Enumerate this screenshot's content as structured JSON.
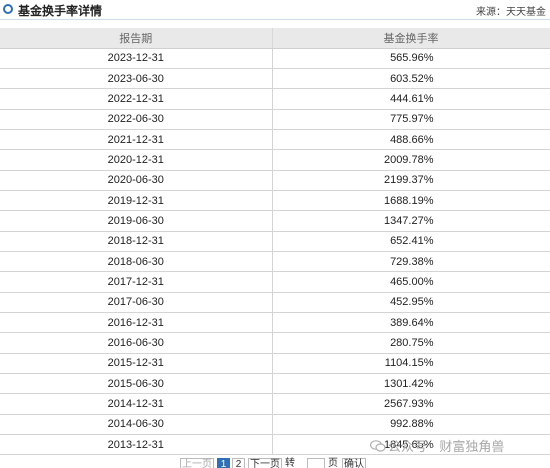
{
  "header": {
    "title": "基金换手率详情",
    "source": "来源：天天基金"
  },
  "table": {
    "columns": [
      "报告期",
      "基金换手率"
    ],
    "rows": [
      {
        "date": "2023-12-31",
        "rate": "565.96%"
      },
      {
        "date": "2023-06-30",
        "rate": "603.52%"
      },
      {
        "date": "2022-12-31",
        "rate": "444.61%"
      },
      {
        "date": "2022-06-30",
        "rate": "775.97%"
      },
      {
        "date": "2021-12-31",
        "rate": "488.66%"
      },
      {
        "date": "2020-12-31",
        "rate": "2009.78%"
      },
      {
        "date": "2020-06-30",
        "rate": "2199.37%"
      },
      {
        "date": "2019-12-31",
        "rate": "1688.19%"
      },
      {
        "date": "2019-06-30",
        "rate": "1347.27%"
      },
      {
        "date": "2018-12-31",
        "rate": "652.41%"
      },
      {
        "date": "2018-06-30",
        "rate": "729.38%"
      },
      {
        "date": "2017-12-31",
        "rate": "465.00%"
      },
      {
        "date": "2017-06-30",
        "rate": "452.95%"
      },
      {
        "date": "2016-12-31",
        "rate": "389.64%"
      },
      {
        "date": "2016-06-30",
        "rate": "280.75%"
      },
      {
        "date": "2015-12-31",
        "rate": "1104.15%"
      },
      {
        "date": "2015-06-30",
        "rate": "1301.42%"
      },
      {
        "date": "2014-12-31",
        "rate": "2567.93%"
      },
      {
        "date": "2014-06-30",
        "rate": "992.88%"
      },
      {
        "date": "2013-12-31",
        "rate": "1845.65%"
      }
    ]
  },
  "pager": {
    "prev": "上一页",
    "page1": "1",
    "page2": "2",
    "next": "下一页",
    "goto": "转到",
    "page_unit": "页",
    "ok": "确认"
  },
  "watermark": {
    "text": "公众号 · 财富独角兽"
  }
}
